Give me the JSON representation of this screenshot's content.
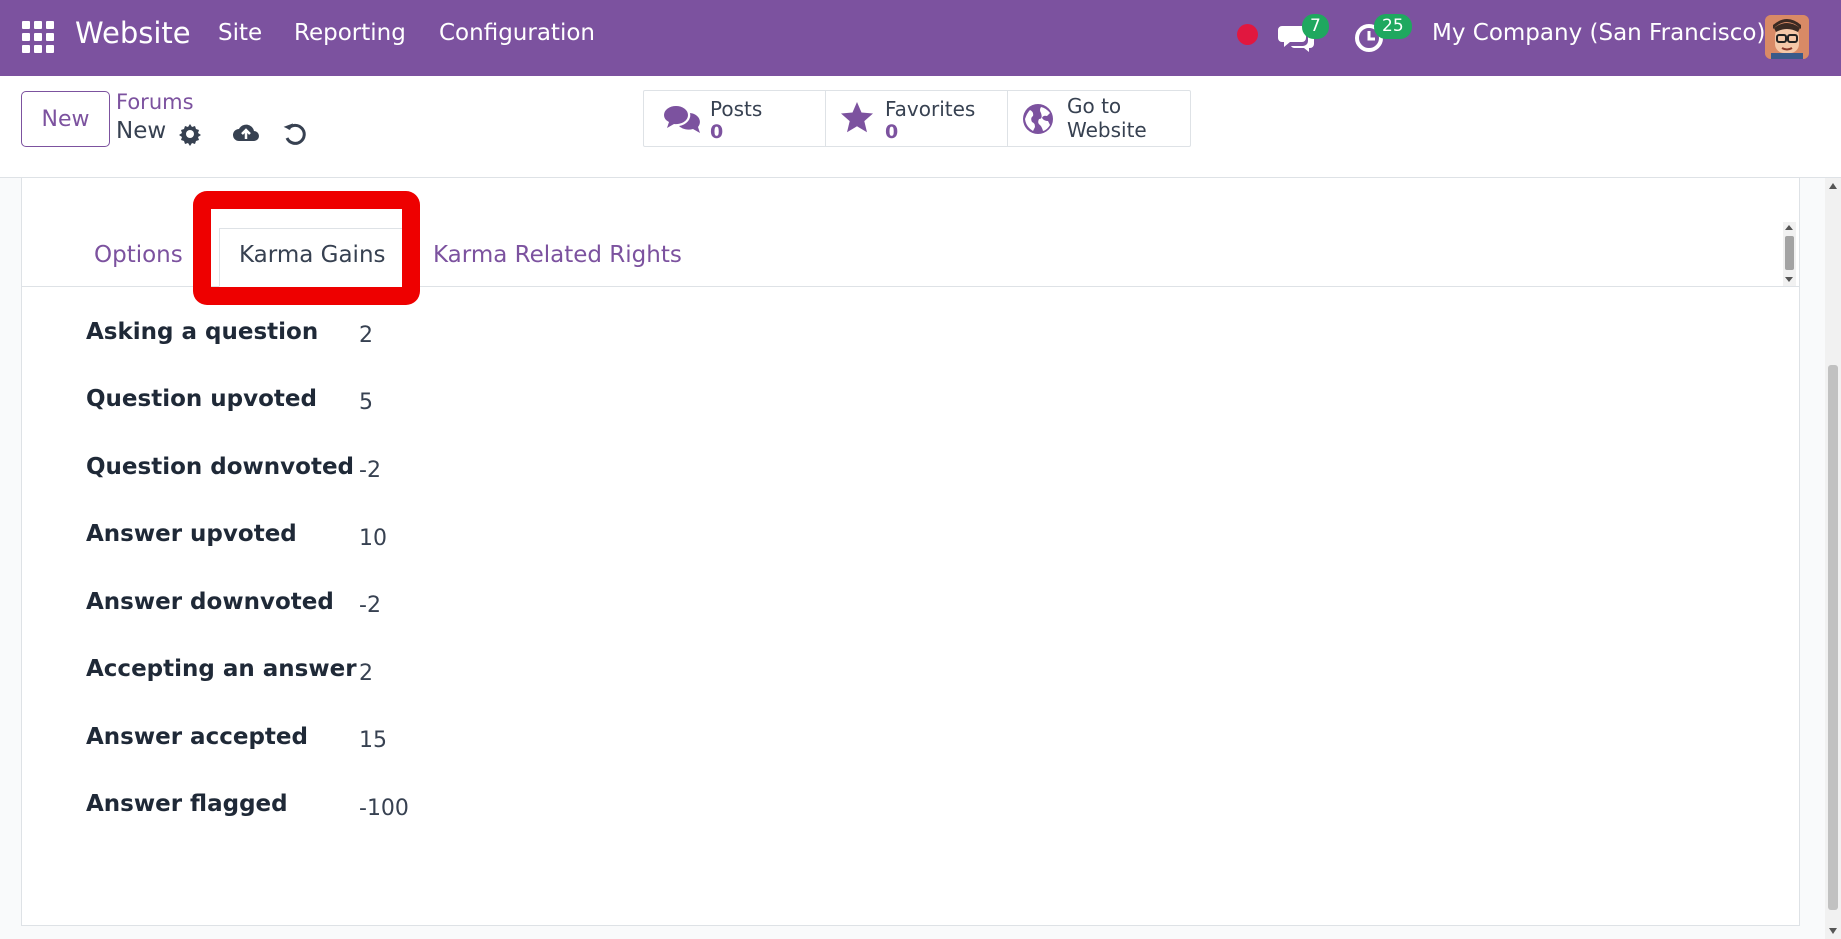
{
  "navbar": {
    "app_name": "Website",
    "menu": [
      "Site",
      "Reporting",
      "Configuration"
    ],
    "messages_badge": "7",
    "activities_badge": "25",
    "company": "My Company (San Francisco)",
    "accent_color": "#7c529f"
  },
  "control_panel": {
    "new_button": "New",
    "breadcrumb_parent": "Forums",
    "breadcrumb_current": "New",
    "smart_buttons": [
      {
        "label": "Posts",
        "value": "0",
        "icon": "comments-icon"
      },
      {
        "label": "Favorites",
        "value": "0",
        "icon": "star-icon"
      },
      {
        "label": "Go to",
        "label2": "Website",
        "icon": "globe-icon"
      }
    ]
  },
  "tabs": [
    {
      "label": "Options",
      "active": false
    },
    {
      "label": "Karma Gains",
      "active": true
    },
    {
      "label": "Karma Related Rights",
      "active": false
    }
  ],
  "karma_gains": [
    {
      "label": "Asking a question",
      "value": "2"
    },
    {
      "label": "Question upvoted",
      "value": "5"
    },
    {
      "label": "Question downvoted",
      "value": "-2"
    },
    {
      "label": "Answer upvoted",
      "value": "10"
    },
    {
      "label": "Answer downvoted",
      "value": "-2"
    },
    {
      "label": "Accepting an answer",
      "value": "2"
    },
    {
      "label": "Answer accepted",
      "value": "15"
    },
    {
      "label": "Answer flagged",
      "value": "-100"
    }
  ],
  "highlight_color": "#ee0000"
}
